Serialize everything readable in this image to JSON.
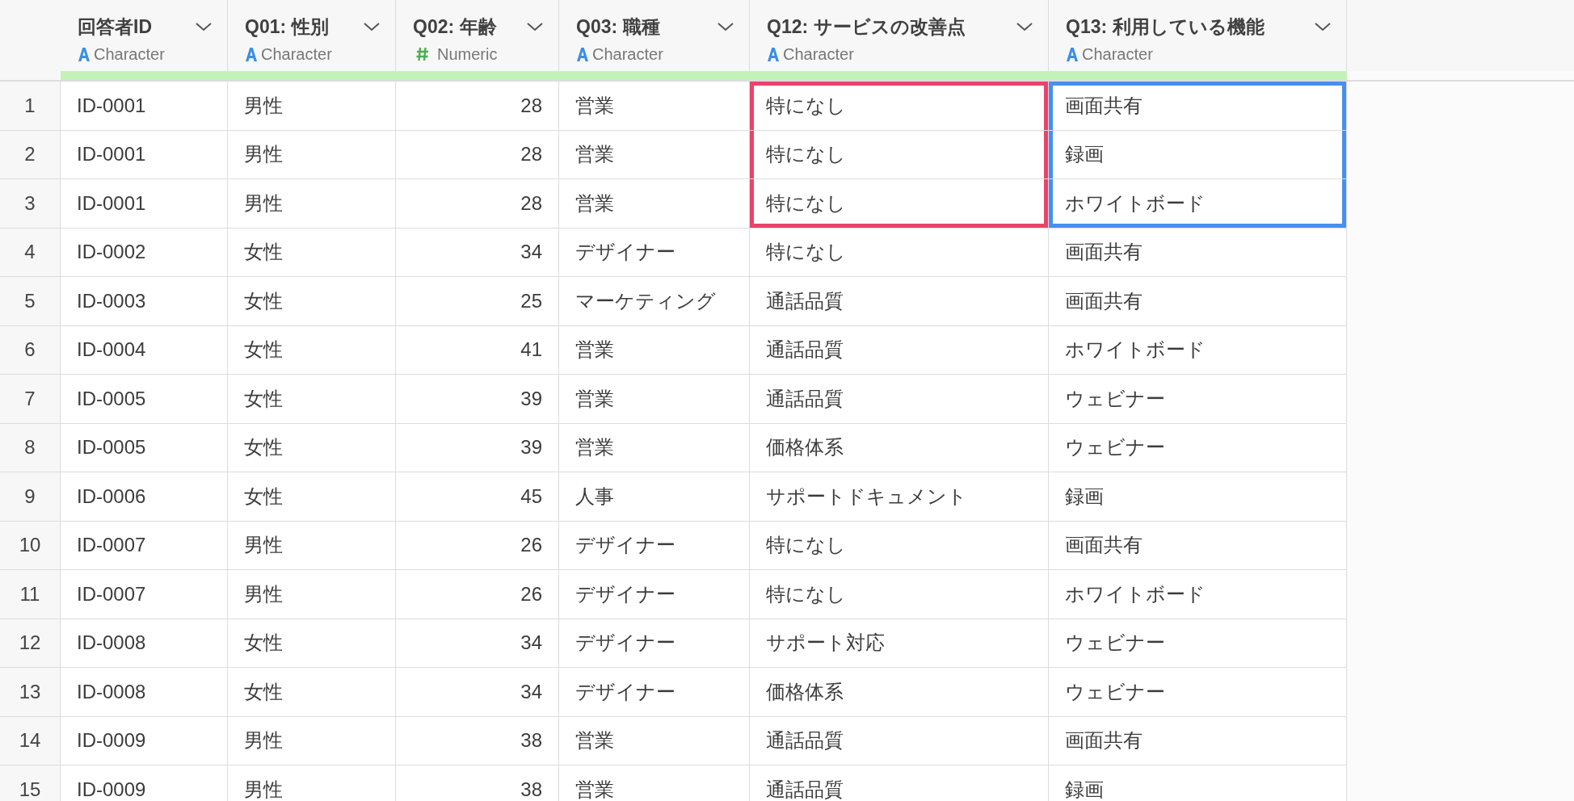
{
  "columns": [
    {
      "name": "回答者ID",
      "type_label": "Character",
      "kind": "character"
    },
    {
      "name": "Q01: 性別",
      "type_label": "Character",
      "kind": "character"
    },
    {
      "name": "Q02: 年齢",
      "type_label": "Numeric",
      "kind": "numeric"
    },
    {
      "name": "Q03: 職種",
      "type_label": "Character",
      "kind": "character"
    },
    {
      "name": "Q12: サービスの改善点",
      "type_label": "Character",
      "kind": "character"
    },
    {
      "name": "Q13: 利用している機能",
      "type_label": "Character",
      "kind": "character"
    }
  ],
  "rows": [
    {
      "number": "1",
      "cells": [
        {
          "text": "ID-0001",
          "selected": false
        },
        {
          "text": "男性",
          "selected": false
        },
        {
          "text": "28",
          "selected": false
        },
        {
          "text": "営業",
          "selected": false
        },
        {
          "text": "特になし",
          "selected": true,
          "color": "#e8446c"
        },
        {
          "text": "画面共有",
          "selected": true,
          "color": "#4590f0"
        }
      ]
    },
    {
      "number": "2",
      "cells": [
        {
          "text": "ID-0001",
          "selected": false
        },
        {
          "text": "男性",
          "selected": false
        },
        {
          "text": "28",
          "selected": false
        },
        {
          "text": "営業",
          "selected": false
        },
        {
          "text": "特になし",
          "selected": true,
          "color": "#e8446c"
        },
        {
          "text": "録画",
          "selected": true,
          "color": "#4590f0"
        }
      ]
    },
    {
      "number": "3",
      "cells": [
        {
          "text": "ID-0001",
          "selected": false
        },
        {
          "text": "男性",
          "selected": false
        },
        {
          "text": "28",
          "selected": false
        },
        {
          "text": "営業",
          "selected": false
        },
        {
          "text": "特になし",
          "selected": true,
          "color": "#e8446c"
        },
        {
          "text": "ホワイトボード",
          "selected": true,
          "color": "#4590f0"
        }
      ]
    },
    {
      "number": "4",
      "cells": [
        {
          "text": "ID-0002",
          "selected": false
        },
        {
          "text": "女性",
          "selected": false
        },
        {
          "text": "34",
          "selected": false
        },
        {
          "text": "デザイナー",
          "selected": false
        },
        {
          "text": "特になし",
          "selected": false
        },
        {
          "text": "画面共有",
          "selected": false
        }
      ]
    },
    {
      "number": "5",
      "cells": [
        {
          "text": "ID-0003",
          "selected": false
        },
        {
          "text": "女性",
          "selected": false
        },
        {
          "text": "25",
          "selected": false
        },
        {
          "text": "マーケティング",
          "selected": false
        },
        {
          "text": "通話品質",
          "selected": false
        },
        {
          "text": "画面共有",
          "selected": false
        }
      ]
    },
    {
      "number": "6",
      "cells": [
        {
          "text": "ID-0004",
          "selected": false
        },
        {
          "text": "女性",
          "selected": false
        },
        {
          "text": "41",
          "selected": false
        },
        {
          "text": "営業",
          "selected": false
        },
        {
          "text": "通話品質",
          "selected": false
        },
        {
          "text": "ホワイトボード",
          "selected": false
        }
      ]
    },
    {
      "number": "7",
      "cells": [
        {
          "text": "ID-0005",
          "selected": false
        },
        {
          "text": "女性",
          "selected": false
        },
        {
          "text": "39",
          "selected": false
        },
        {
          "text": "営業",
          "selected": false
        },
        {
          "text": "通話品質",
          "selected": false
        },
        {
          "text": "ウェビナー",
          "selected": false
        }
      ]
    },
    {
      "number": "8",
      "cells": [
        {
          "text": "ID-0005",
          "selected": false
        },
        {
          "text": "女性",
          "selected": false
        },
        {
          "text": "39",
          "selected": false
        },
        {
          "text": "営業",
          "selected": false
        },
        {
          "text": "価格体系",
          "selected": false
        },
        {
          "text": "ウェビナー",
          "selected": false
        }
      ]
    },
    {
      "number": "9",
      "cells": [
        {
          "text": "ID-0006",
          "selected": false
        },
        {
          "text": "女性",
          "selected": false
        },
        {
          "text": "45",
          "selected": false
        },
        {
          "text": "人事",
          "selected": false
        },
        {
          "text": "サポートドキュメント",
          "selected": false
        },
        {
          "text": "録画",
          "selected": false
        }
      ]
    },
    {
      "number": "10",
      "cells": [
        {
          "text": "ID-0007",
          "selected": false
        },
        {
          "text": "男性",
          "selected": false
        },
        {
          "text": "26",
          "selected": false
        },
        {
          "text": "デザイナー",
          "selected": false
        },
        {
          "text": "特になし",
          "selected": false
        },
        {
          "text": "画面共有",
          "selected": false
        }
      ]
    },
    {
      "number": "11",
      "cells": [
        {
          "text": "ID-0007",
          "selected": false
        },
        {
          "text": "男性",
          "selected": false
        },
        {
          "text": "26",
          "selected": false
        },
        {
          "text": "デザイナー",
          "selected": false
        },
        {
          "text": "特になし",
          "selected": false
        },
        {
          "text": "ホワイトボード",
          "selected": false
        }
      ]
    },
    {
      "number": "12",
      "cells": [
        {
          "text": "ID-0008",
          "selected": false
        },
        {
          "text": "女性",
          "selected": false
        },
        {
          "text": "34",
          "selected": false
        },
        {
          "text": "デザイナー",
          "selected": false
        },
        {
          "text": "サポート対応",
          "selected": false
        },
        {
          "text": "ウェビナー",
          "selected": false
        }
      ]
    },
    {
      "number": "13",
      "cells": [
        {
          "text": "ID-0008",
          "selected": false
        },
        {
          "text": "女性",
          "selected": false
        },
        {
          "text": "34",
          "selected": false
        },
        {
          "text": "デザイナー",
          "selected": false
        },
        {
          "text": "価格体系",
          "selected": false
        },
        {
          "text": "ウェビナー",
          "selected": false
        }
      ]
    },
    {
      "number": "14",
      "cells": [
        {
          "text": "ID-0009",
          "selected": false
        },
        {
          "text": "男性",
          "selected": false
        },
        {
          "text": "38",
          "selected": false
        },
        {
          "text": "営業",
          "selected": false
        },
        {
          "text": "通話品質",
          "selected": false
        },
        {
          "text": "画面共有",
          "selected": false
        }
      ]
    },
    {
      "number": "15",
      "cells": [
        {
          "text": "ID-0009",
          "selected": false
        },
        {
          "text": "男性",
          "selected": false
        },
        {
          "text": "38",
          "selected": false
        },
        {
          "text": "営業",
          "selected": false
        },
        {
          "text": "通話品質",
          "selected": false
        },
        {
          "text": "録画",
          "selected": false
        }
      ]
    }
  ]
}
